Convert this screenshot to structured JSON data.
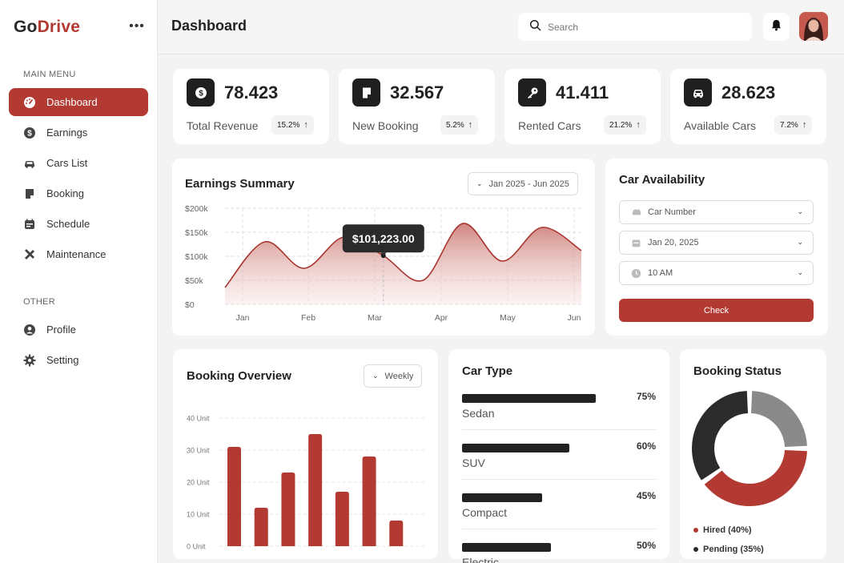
{
  "brand": {
    "part1": "Go",
    "part2": "Drive"
  },
  "sidebar": {
    "more_icon": "more-horizontal-icon",
    "main_menu_label": "MAIN MENU",
    "main_items": [
      {
        "label": "Dashboard",
        "icon": "dashboard-gauge-icon",
        "active": true
      },
      {
        "label": "Earnings",
        "icon": "dollar-coin-icon"
      },
      {
        "label": "Cars List",
        "icon": "car-icon"
      },
      {
        "label": "Booking",
        "icon": "booking-icon"
      },
      {
        "label": "Schedule",
        "icon": "calendar-icon"
      },
      {
        "label": "Maintenance",
        "icon": "tools-icon"
      }
    ],
    "other_label": "OTHER",
    "other_items": [
      {
        "label": "Profile",
        "icon": "user-icon"
      },
      {
        "label": "Setting",
        "icon": "gear-icon"
      }
    ]
  },
  "header": {
    "title": "Dashboard",
    "search_placeholder": "Search",
    "icons": [
      "search-icon",
      "bell-icon",
      "avatar"
    ]
  },
  "stats": [
    {
      "value": "78.423",
      "label": "Total Revenue",
      "change": "15.2%",
      "icon": "dollar-icon"
    },
    {
      "value": "32.567",
      "label": "New Booking",
      "change": "5.2%",
      "icon": "booking-icon"
    },
    {
      "value": "41.411",
      "label": "Rented Cars",
      "change": "21.2%",
      "icon": "key-icon"
    },
    {
      "value": "28.623",
      "label": "Available Cars",
      "change": "7.2%",
      "icon": "car-icon"
    }
  ],
  "earnings": {
    "title": "Earnings Summary",
    "date_range": "Jan 2025 - Jun 2025",
    "tooltip": "$101,223.00"
  },
  "availability": {
    "title": "Car Availability",
    "car_number_placeholder": "Car Number",
    "date_value": "Jan 20, 2025",
    "time_value": "10 AM",
    "check_label": "Check"
  },
  "booking_overview": {
    "title": "Booking Overview",
    "period": "Weekly"
  },
  "car_type": {
    "title": "Car Type",
    "items": [
      {
        "name": "Sedan",
        "pct": "75%",
        "value": 75
      },
      {
        "name": "SUV",
        "pct": "60%",
        "value": 60
      },
      {
        "name": "Compact",
        "pct": "45%",
        "value": 45
      },
      {
        "name": "Electric",
        "pct": "50%",
        "value": 50
      }
    ]
  },
  "booking_status": {
    "title": "Booking Status",
    "legend": [
      {
        "label": "Hired (40%)",
        "color": "#b23a33"
      },
      {
        "label": "Pending (35%)",
        "color": "#2b2b2b"
      }
    ]
  },
  "colors": {
    "accent": "#b23a33",
    "dark": "#1f1f1f",
    "grey": "#8a8a8a"
  },
  "chart_data": [
    {
      "type": "area",
      "title": "Earnings Summary",
      "x": [
        "Jan",
        "Feb",
        "Mar",
        "Apr",
        "May",
        "Jun"
      ],
      "series": [
        {
          "values": [
            35000,
            130000,
            75000,
            140000,
            101223,
            50000,
            168000,
            90000,
            160000,
            112000
          ]
        }
      ],
      "yticks": [
        "$0",
        "$50k",
        "$100k",
        "$150k",
        "$200k"
      ],
      "ylim": [
        0,
        200000
      ],
      "grid": true
    },
    {
      "type": "bar",
      "title": "Booking Overview",
      "values": [
        31,
        12,
        23,
        35,
        17,
        28,
        8
      ],
      "yticks": [
        "0 Unit",
        "10 Unit",
        "20 Unit",
        "30 Unit",
        "40 Unit"
      ],
      "ylim": [
        0,
        40
      ],
      "grid": true
    },
    {
      "type": "pie",
      "title": "Booking Status",
      "slices": [
        {
          "label": "Hired",
          "value": 40,
          "color": "#b23a33"
        },
        {
          "label": "Pending",
          "value": 35,
          "color": "#2b2b2b"
        },
        {
          "label": "",
          "value": 25,
          "color": "#8a8a8a"
        }
      ]
    }
  ]
}
